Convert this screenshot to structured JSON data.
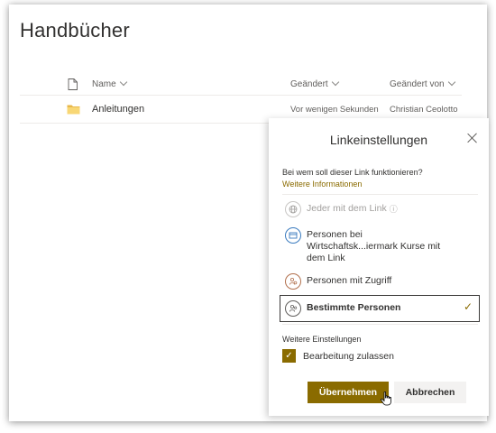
{
  "library": {
    "title": "Handbücher",
    "columns": {
      "name": "Name",
      "modified": "Geändert",
      "modified_by": "Geändert von"
    },
    "icons": {
      "file": "file-icon",
      "folder": "folder-icon"
    },
    "rows": [
      {
        "name": "Anleitungen",
        "modified": "Vor wenigen Sekunden",
        "modified_by": "Christian Ceolotto"
      }
    ]
  },
  "panel": {
    "title": "Linkeinstellungen",
    "question": "Bei wem soll dieser Link funktionieren?",
    "more_info": "Weitere Informationen",
    "options": [
      {
        "label": "Jeder mit dem Link",
        "icon": "globe-icon",
        "disabled": true
      },
      {
        "label": "Personen bei Wirtschaftsk...iermark Kurse mit dem Link",
        "icon": "building-icon",
        "disabled": false
      },
      {
        "label": "Personen mit Zugriff",
        "icon": "people-access-icon",
        "disabled": false
      },
      {
        "label": "Bestimmte Personen",
        "icon": "specific-people-icon",
        "disabled": false,
        "selected": true
      }
    ],
    "settings_label": "Weitere Einstellungen",
    "allow_edit": {
      "label": "Bearbeitung zulassen",
      "checked": true
    },
    "apply_label": "Übernehmen",
    "cancel_label": "Abbrechen",
    "colors": {
      "accent": "#8a6b00",
      "text": "#323130"
    }
  }
}
